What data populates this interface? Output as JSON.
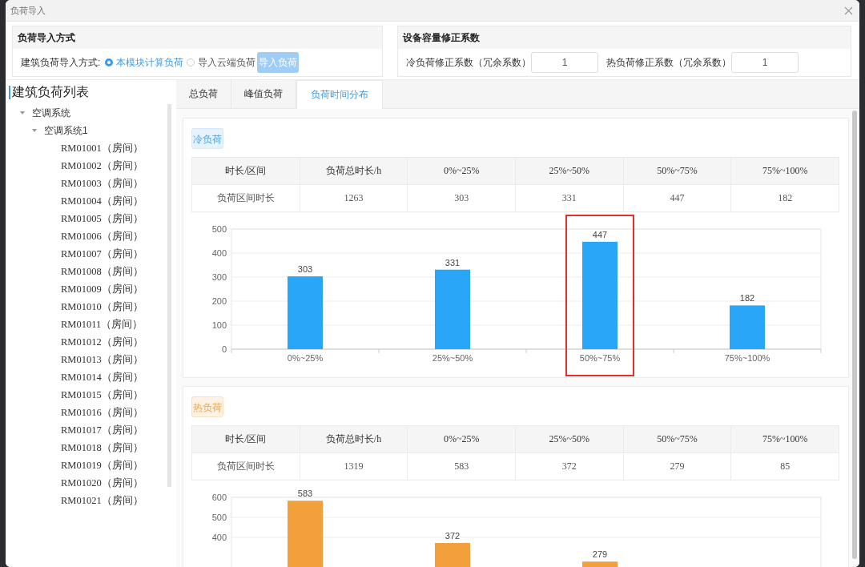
{
  "dialog": {
    "title": "负荷导入"
  },
  "import_method": {
    "title": "负荷导入方式",
    "label": "建筑负荷导入方式:",
    "options": [
      {
        "label": "本模块计算负荷",
        "selected": true
      },
      {
        "label": "导入云端负荷",
        "selected": false
      }
    ],
    "button": {
      "label": "导入负荷",
      "disabled": true
    }
  },
  "correction": {
    "title": "设备容量修正系数",
    "fields": [
      {
        "label": "冷负荷修正系数（冗余系数）",
        "value": "1"
      },
      {
        "label": "热负荷修正系数（冗余系数）",
        "value": "1"
      }
    ]
  },
  "sidebar": {
    "title": "建筑负荷列表",
    "tree": [
      {
        "label": "空调系统",
        "expanded": true,
        "children": [
          {
            "label": "空调系统1",
            "expanded": true,
            "children": [
              {
                "label": "RM01001（房间）"
              },
              {
                "label": "RM01002（房间）"
              },
              {
                "label": "RM01003（房间）"
              },
              {
                "label": "RM01004（房间）"
              },
              {
                "label": "RM01005（房间）"
              },
              {
                "label": "RM01006（房间）"
              },
              {
                "label": "RM01007（房间）"
              },
              {
                "label": "RM01008（房间）"
              },
              {
                "label": "RM01009（房间）"
              },
              {
                "label": "RM01010（房间）"
              },
              {
                "label": "RM01011（房间）"
              },
              {
                "label": "RM01012（房间）"
              },
              {
                "label": "RM01013（房间）"
              },
              {
                "label": "RM01014（房间）"
              },
              {
                "label": "RM01015（房间）"
              },
              {
                "label": "RM01016（房间）"
              },
              {
                "label": "RM01017（房间）"
              },
              {
                "label": "RM01018（房间）"
              },
              {
                "label": "RM01019（房间）"
              },
              {
                "label": "RM01020（房间）"
              },
              {
                "label": "RM01021（房间）"
              }
            ]
          }
        ]
      }
    ]
  },
  "tabs": [
    {
      "label": "总负荷",
      "selected": false
    },
    {
      "label": "峰值负荷",
      "selected": false
    },
    {
      "label": "负荷时间分布",
      "selected": true
    }
  ],
  "sections": [
    {
      "kind": "cold",
      "tag": "冷负荷",
      "table": {
        "columns": [
          "时长/区间",
          "负荷总时长/h",
          "0%~25%",
          "25%~50%",
          "50%~75%",
          "75%~100%"
        ],
        "rows": [
          [
            "负荷区间时长",
            "1263",
            "303",
            "331",
            "447",
            "182"
          ]
        ]
      },
      "chart_data": {
        "type": "bar",
        "categories": [
          "0%~25%",
          "25%~50%",
          "50%~75%",
          "75%~100%"
        ],
        "series": [
          {
            "color": "#2aa6f8",
            "values": [
              303,
              331,
              447,
              182
            ]
          }
        ],
        "ylim": [
          0,
          500
        ],
        "yticks": [
          0,
          100,
          200,
          300,
          400,
          500
        ],
        "grid": true,
        "data_labels": true
      },
      "highlighted_bars": [
        false,
        false,
        true,
        false
      ]
    },
    {
      "kind": "heat",
      "tag": "热负荷",
      "table": {
        "columns": [
          "时长/区间",
          "负荷总时长/h",
          "0%~25%",
          "25%~50%",
          "50%~75%",
          "75%~100%"
        ],
        "rows": [
          [
            "负荷区间时长",
            "1319",
            "583",
            "372",
            "279",
            "85"
          ]
        ]
      },
      "chart_data": {
        "type": "bar",
        "series": [
          {
            "color": "#f2a03b",
            "values": [
              583,
              372,
              279,
              null
            ]
          }
        ],
        "ylim": [
          0,
          600
        ],
        "yticks": [
          400,
          500,
          600
        ],
        "grid": true,
        "value_labels": [
          "583",
          "372",
          "279",
          null
        ]
      }
    }
  ]
}
